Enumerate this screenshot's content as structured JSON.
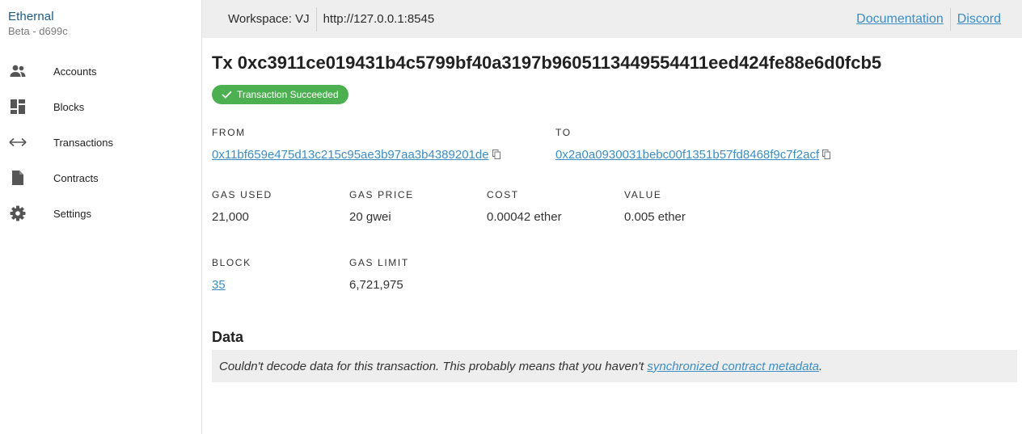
{
  "app": {
    "name": "Ethernal",
    "version": "Beta - d699c"
  },
  "sidebar": {
    "items": [
      {
        "label": "Accounts",
        "icon": "people-icon"
      },
      {
        "label": "Blocks",
        "icon": "dashboard-icon"
      },
      {
        "label": "Transactions",
        "icon": "swap-arrows-icon"
      },
      {
        "label": "Contracts",
        "icon": "file-icon"
      },
      {
        "label": "Settings",
        "icon": "gear-icon"
      }
    ]
  },
  "topbar": {
    "workspace": "Workspace: VJ",
    "rpc": "http://127.0.0.1:8545",
    "documentation": "Documentation",
    "discord": "Discord"
  },
  "tx": {
    "title": "Tx 0xc3911ce019431b4c5799bf40a3197b9605113449554411eed424fe88e6d0fcb5",
    "status": "Transaction Succeeded",
    "from_label": "FROM",
    "from": "0x11bf659e475d13c215c95ae3b97aa3b4389201de",
    "to_label": "TO",
    "to": "0x2a0a0930031bebc00f1351b57fd8468f9c7f2acf",
    "gas_used_label": "GAS USED",
    "gas_used": "21,000",
    "gas_price_label": "GAS PRICE",
    "gas_price": "20 gwei",
    "cost_label": "COST",
    "cost": "0.00042 ether",
    "value_label": "VALUE",
    "value": "0.005 ether",
    "block_label": "BLOCK",
    "block": "35",
    "gas_limit_label": "GAS LIMIT",
    "gas_limit": "6,721,975"
  },
  "data_section": {
    "title": "Data",
    "message": "Couldn't decode data for this transaction. This probably means that you haven't ",
    "link": "synchronized contract metadata",
    "suffix": "."
  },
  "colors": {
    "accent": "#3c8dc4",
    "success": "#4caf50",
    "brand": "#1f5a86"
  }
}
